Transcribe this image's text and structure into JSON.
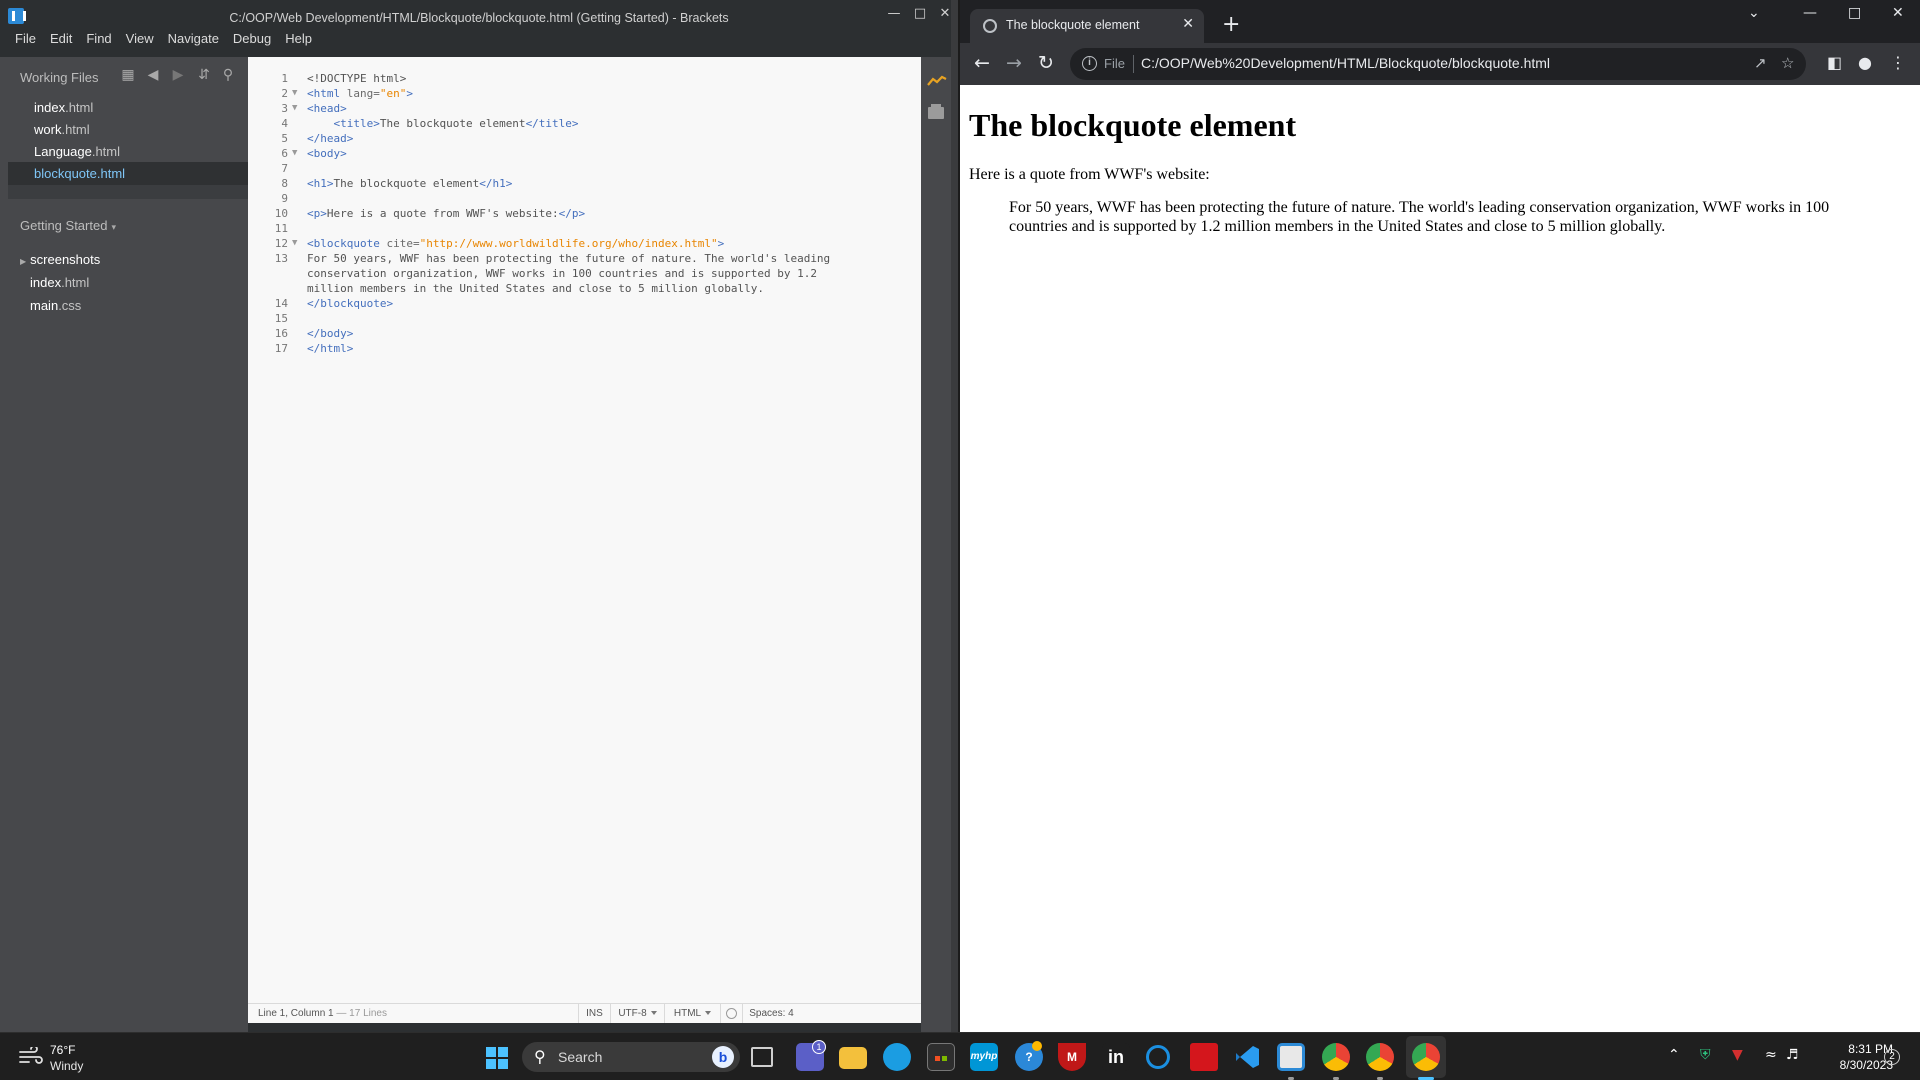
{
  "brackets": {
    "window_title": "C:/OOP/Web Development/HTML/Blockquote/blockquote.html (Getting Started) - Brackets",
    "menu": [
      "File",
      "Edit",
      "Find",
      "View",
      "Navigate",
      "Debug",
      "Help"
    ],
    "sidebar": {
      "working_files_label": "Working Files",
      "working_files": [
        {
          "name": "index",
          "ext": ".html"
        },
        {
          "name": "work",
          "ext": ".html"
        },
        {
          "name": "Language",
          "ext": ".html"
        },
        {
          "name": "blockquote",
          "ext": ".html",
          "selected": true
        }
      ],
      "project_label": "Getting Started",
      "tree": [
        {
          "name": "screenshots",
          "ext": "",
          "folder": true
        },
        {
          "name": "index",
          "ext": ".html"
        },
        {
          "name": "main",
          "ext": ".css"
        }
      ]
    },
    "code": {
      "line_numbers": [
        "1",
        "2",
        "3",
        "4",
        "5",
        "6",
        "7",
        "8",
        "9",
        "10",
        "11",
        "12",
        "13",
        "14",
        "15",
        "16",
        "17"
      ],
      "l1": "<!DOCTYPE html>",
      "l2_open": "<html",
      "l2_attr": " lang=",
      "l2_val": "\"en\"",
      "l2_close": ">",
      "l3": "<head>",
      "l4_open": "<title>",
      "l4_text": "The blockquote element",
      "l4_close": "</title>",
      "l5": "</head>",
      "l6": "<body>",
      "l8_open": "<h1>",
      "l8_text": "The blockquote element",
      "l8_close": "</h1>",
      "l10_open": "<p>",
      "l10_text": "Here is a quote from WWF's website:",
      "l10_close": "</p>",
      "l12_open": "<blockquote",
      "l12_attr": " cite=",
      "l12_val": "\"http://www.worldwildlife.org/who/index.html\"",
      "l12_close": ">",
      "l13_a": "For 50 years, WWF has been protecting the future of nature. The world's leading",
      "l13_b": "conservation organization, WWF works in 100 countries and is supported by 1.2",
      "l13_c": "million members in the United States and close to 5 million globally.",
      "l14": "</blockquote>",
      "l16": "</body>",
      "l17": "</html>"
    },
    "statusbar": {
      "position": "Line 1, Column 1",
      "lines": "— 17 Lines",
      "mode": "INS",
      "encoding": "UTF-8",
      "language": "HTML",
      "spaces": "Spaces: 4"
    }
  },
  "chrome": {
    "tab_title": "The blockquote element",
    "scheme_label": "File",
    "url": "C:/OOP/Web%20Development/HTML/Blockquote/blockquote.html",
    "page": {
      "heading": "The blockquote element",
      "intro": "Here is a quote from WWF's website:",
      "quote": "For 50 years, WWF has been protecting the future of nature. The world's leading conservation organization, WWF works in 100 countries and is supported by 1.2 million members in the United States and close to 5 million globally."
    }
  },
  "taskbar": {
    "weather_temp": "76°F",
    "weather_condition": "Windy",
    "search_label": "Search",
    "teams_badge": "1",
    "time": "8:31 PM",
    "date": "8/30/2023",
    "notification_count": "2",
    "apps": [
      {
        "name": "task-view",
        "color": "#5a5a5a",
        "label": ""
      },
      {
        "name": "teams",
        "color": "#5b5fc7",
        "label": ""
      },
      {
        "name": "file-explorer",
        "color": "#f3c03c",
        "label": ""
      },
      {
        "name": "edge",
        "color": "#1b9de2",
        "label": ""
      },
      {
        "name": "microsoft-store",
        "color": "#3a3a3a",
        "label": ""
      },
      {
        "name": "myhp",
        "color": "#0096d6",
        "label": "myhp"
      },
      {
        "name": "get-help",
        "color": "#2b88d8",
        "label": "?"
      },
      {
        "name": "mcafee",
        "color": "#c01818",
        "label": "M"
      },
      {
        "name": "linkedin",
        "color": "#1f1f1f",
        "label": "in"
      },
      {
        "name": "cortana",
        "color": "#1b8fe0",
        "label": ""
      },
      {
        "name": "acrobat",
        "color": "#d4161c",
        "label": ""
      },
      {
        "name": "vscode",
        "color": "#1f1f1f",
        "label": ""
      },
      {
        "name": "brackets",
        "color": "#e8e8e8",
        "label": ""
      },
      {
        "name": "chrome",
        "color": "#ea4335",
        "label": ""
      },
      {
        "name": "chrome-profile",
        "color": "#ea4335",
        "label": ""
      },
      {
        "name": "chrome-active",
        "color": "#ea4335",
        "label": ""
      }
    ],
    "colors": {
      "accent": "#4cc2ff",
      "bracket_blue": "#2c8ad6",
      "tag_blue": "#446fbd",
      "string_orange": "#e88501"
    }
  }
}
